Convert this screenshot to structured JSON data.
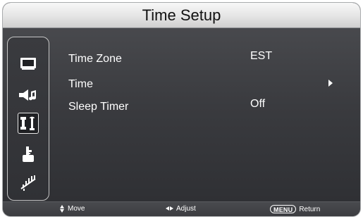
{
  "window": {
    "title": "Time Setup"
  },
  "sidebar": {
    "items": [
      {
        "icon": "picture-icon",
        "selected": false
      },
      {
        "icon": "sound-icon",
        "selected": false
      },
      {
        "icon": "setup-icon",
        "selected": true
      },
      {
        "icon": "lock-icon",
        "selected": false
      },
      {
        "icon": "channel-icon",
        "selected": false
      }
    ]
  },
  "menu": {
    "items": [
      {
        "label": "Time Zone",
        "value": "EST",
        "has_submenu": false
      },
      {
        "label": "Time",
        "value": "",
        "has_submenu": true
      },
      {
        "label": "Sleep Timer",
        "value": "Off",
        "has_submenu": false
      }
    ]
  },
  "footer": {
    "move_label": "Move",
    "adjust_label": "Adjust",
    "menu_key_label": "MENU",
    "return_label": "Return"
  },
  "colors": {
    "panel_background": "#333539",
    "title_bar": "#e4e4e4",
    "text": "#ffffff",
    "title_text": "#111111"
  }
}
